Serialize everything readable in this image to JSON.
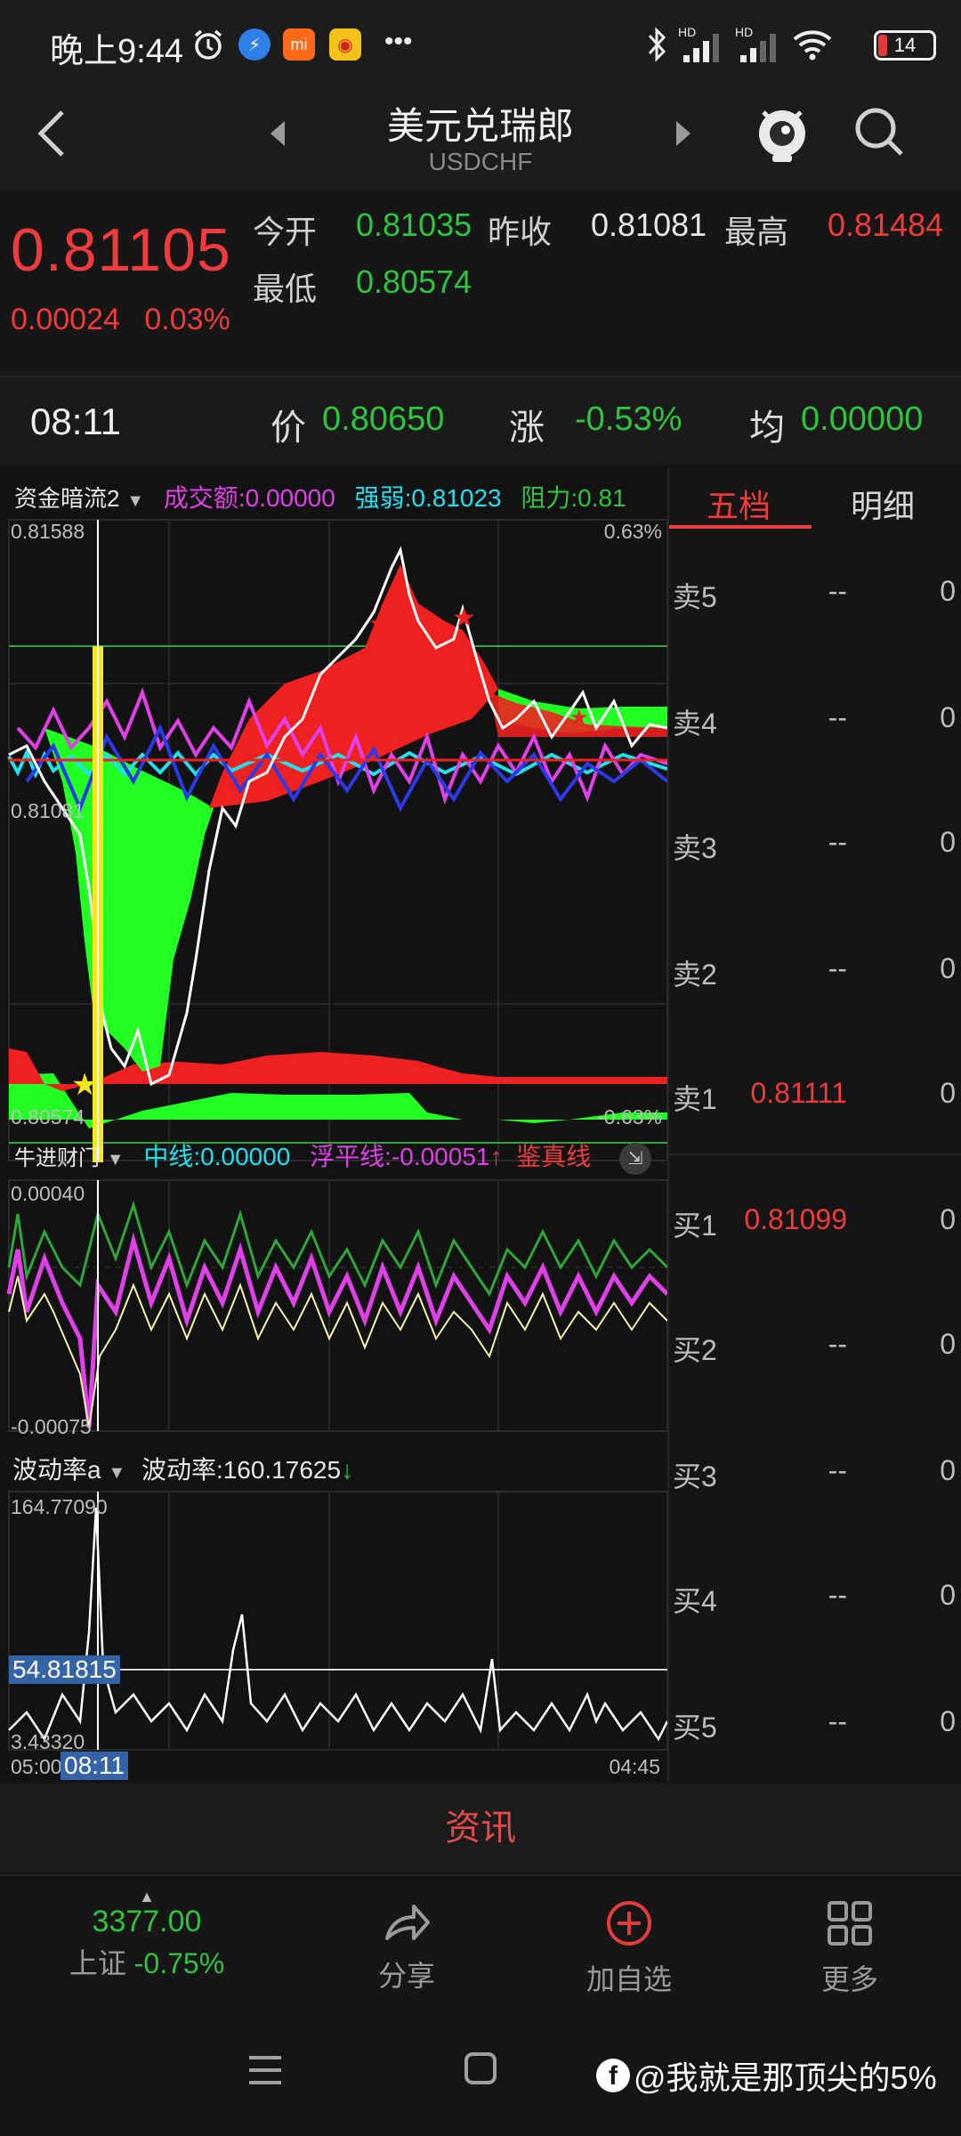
{
  "status_bar": {
    "time": "晚上9:44",
    "dots": "•••",
    "battery": "14",
    "hd1": "HD",
    "hd2": "HD"
  },
  "header": {
    "title": "美元兑瑞郎",
    "subtitle": "USDCHF"
  },
  "quote": {
    "price": "0.81105",
    "change": "0.00024",
    "change_pct": "0.03%",
    "open_label": "今开",
    "open": "0.81035",
    "prev_close_label": "昨收",
    "prev_close": "0.81081",
    "high_label": "最高",
    "high": "0.81484",
    "low_label": "最低",
    "low": "0.80574"
  },
  "crosshair": {
    "time": "08:11",
    "price_label": "价",
    "price": "0.80650",
    "change_label": "涨",
    "change": "-0.53%",
    "avg_label": "均",
    "avg": "0.00000"
  },
  "main_chart": {
    "indicator_name": "资金暗流2",
    "turnover_label": "成交额:",
    "turnover": "0.00000",
    "strength_label": "强弱:",
    "strength": "0.81023",
    "resistance_label": "阻力:",
    "resistance": "0.81",
    "y_top": "0.81588",
    "y_mid": "0.81081",
    "y_bottom": "0.80574",
    "pct_top": "0.63%",
    "pct_bottom": "-0.63%"
  },
  "sub_chart1": {
    "indicator_name": "牛进财门",
    "mid_label": "中线:",
    "mid": "0.00000",
    "float_label": "浮平线:",
    "float_value": "-0.00051",
    "float_arrow": "↑",
    "verify_label": "鉴真线",
    "y_top": "0.00040",
    "y_bottom": "-0.00075"
  },
  "sub_chart2": {
    "indicator_name": "波动率a",
    "vol_label": "波动率:",
    "vol": "160.17625",
    "vol_arrow": "↓",
    "y_top": "164.77090",
    "y_mid": "54.81815",
    "y_bottom": "3.43320",
    "x_start": "05:00",
    "x_cursor": "08:11",
    "x_end": "04:45"
  },
  "order_book": {
    "tab_five": "五档",
    "tab_detail": "明细",
    "rows": [
      {
        "label": "卖5",
        "price": "--",
        "vol": "0"
      },
      {
        "label": "卖4",
        "price": "--",
        "vol": "0"
      },
      {
        "label": "卖3",
        "price": "--",
        "vol": "0"
      },
      {
        "label": "卖2",
        "price": "--",
        "vol": "0"
      },
      {
        "label": "卖1",
        "price": "0.81111",
        "vol": "0"
      },
      {
        "label": "买1",
        "price": "0.81099",
        "vol": "0"
      },
      {
        "label": "买2",
        "price": "--",
        "vol": "0"
      },
      {
        "label": "买3",
        "price": "--",
        "vol": "0"
      },
      {
        "label": "买4",
        "price": "--",
        "vol": "0"
      },
      {
        "label": "买5",
        "price": "--",
        "vol": "0"
      }
    ]
  },
  "news_tab": "资讯",
  "bottom_bar": {
    "index_value": "3377.00",
    "index_name": "上证",
    "index_change": "-0.75%",
    "share": "分享",
    "add_watch": "加自选",
    "more": "更多"
  },
  "watermark": "@我就是那顶尖的5%",
  "colors": {
    "red": "#ef3b3b",
    "green": "#2fc43f",
    "bright_green": "#22ff22",
    "cyan": "#22e0f0",
    "magenta": "#e040e8",
    "yellow": "#f4e81c"
  }
}
